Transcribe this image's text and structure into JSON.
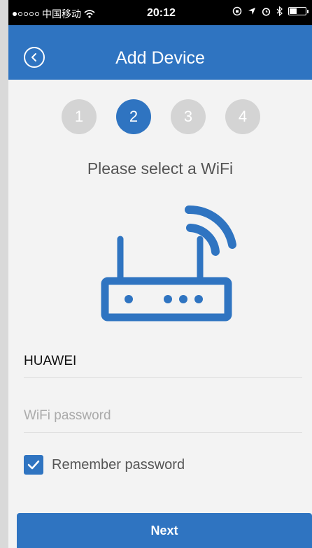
{
  "status_bar": {
    "carrier": "中国移动",
    "time": "20:12",
    "icons": [
      "signal-dots-icon",
      "wifi-icon",
      "orientation-lock-icon",
      "location-icon",
      "alarm-icon",
      "bluetooth-icon",
      "battery-icon"
    ]
  },
  "header": {
    "title": "Add Device",
    "back_icon": "back-circle-icon"
  },
  "steps": [
    {
      "label": "1",
      "active": false
    },
    {
      "label": "2",
      "active": true
    },
    {
      "label": "3",
      "active": false
    },
    {
      "label": "4",
      "active": false
    }
  ],
  "prompt": "Please select a WiFi",
  "illustration": "router-wifi-icon",
  "form": {
    "wifi_name": "HUAWEI",
    "wifi_password_placeholder": "WiFi password",
    "remember_label": "Remember password",
    "remember_checked": true
  },
  "next_label": "Next",
  "colors": {
    "accent": "#2f74c1",
    "inactive_step": "#d4d4d4",
    "background": "#f3f3f3"
  }
}
